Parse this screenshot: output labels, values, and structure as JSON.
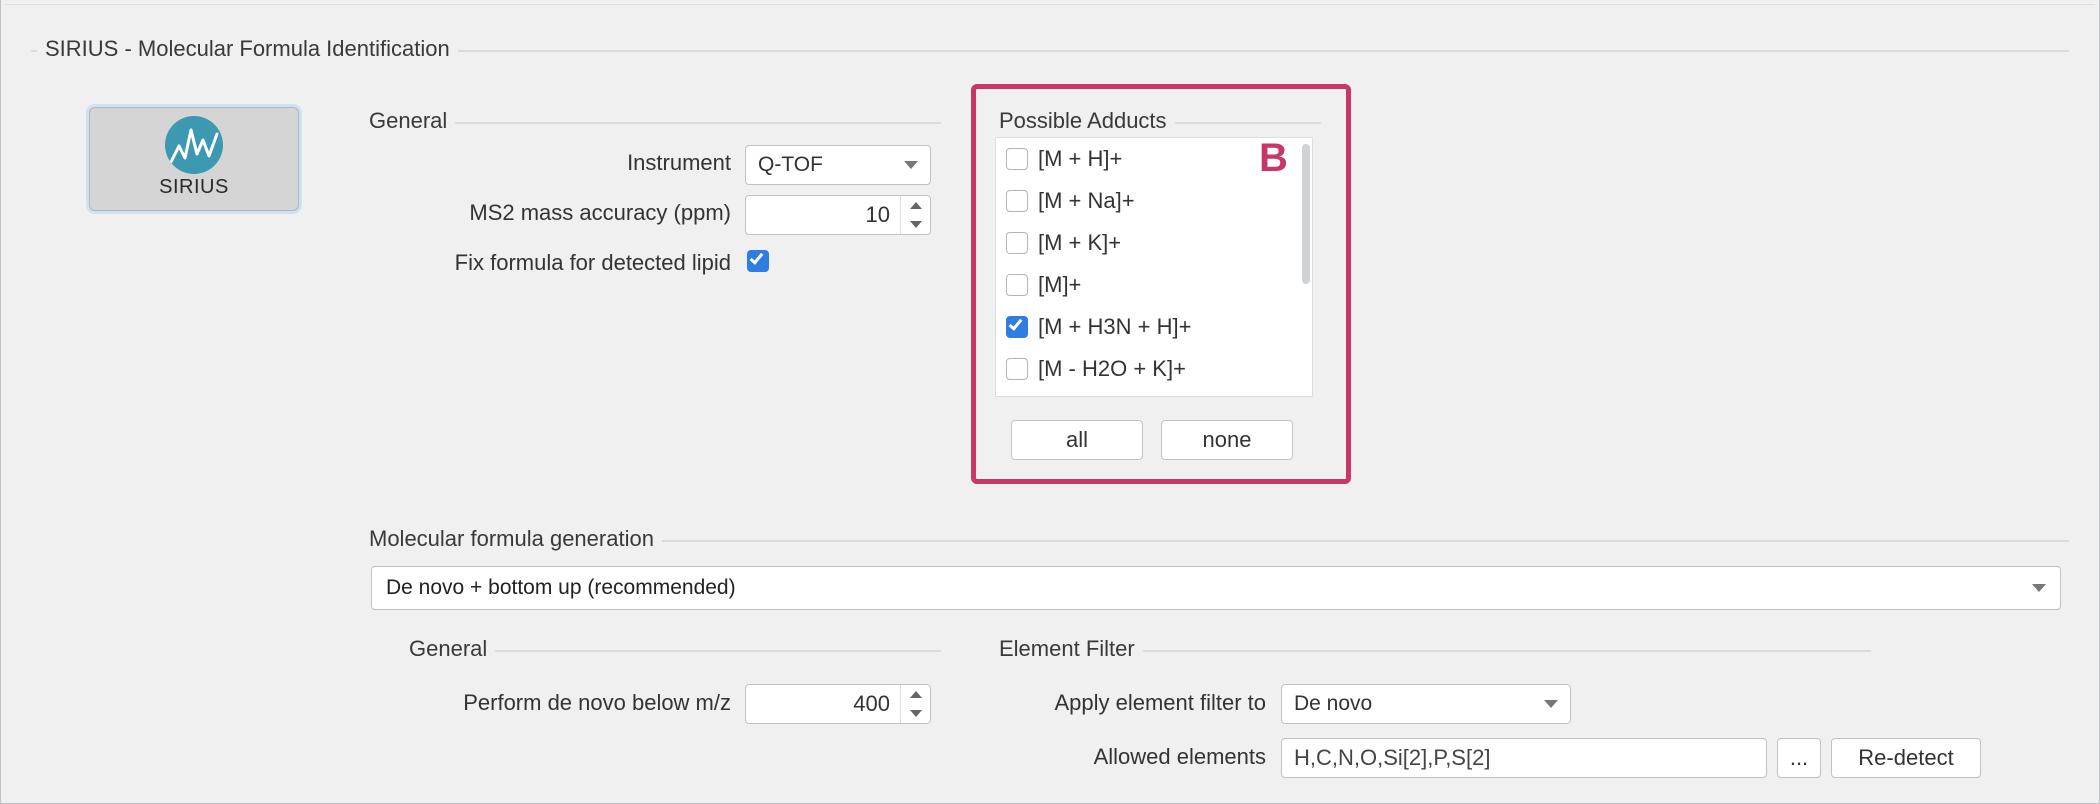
{
  "main_title": "SIRIUS - Molecular Formula Identification",
  "sirius_button": {
    "label": "SIRIUS"
  },
  "general": {
    "title": "General",
    "instrument_label": "Instrument",
    "instrument_value": "Q-TOF",
    "ms2_label": "MS2 mass accuracy (ppm)",
    "ms2_value": "10",
    "fix_label": "Fix formula for detected lipid",
    "fix_checked": true
  },
  "adducts": {
    "title": "Possible Adducts",
    "items": [
      {
        "label": "[M + H]+",
        "checked": false
      },
      {
        "label": "[M + Na]+",
        "checked": false
      },
      {
        "label": "[M + K]+",
        "checked": false
      },
      {
        "label": "[M]+",
        "checked": false
      },
      {
        "label": "[M + H3N + H]+",
        "checked": true
      },
      {
        "label": "[M - H2O + K]+",
        "checked": false
      }
    ],
    "all_label": "all",
    "none_label": "none"
  },
  "annotation": {
    "B": "B"
  },
  "mfg": {
    "title": "Molecular formula generation",
    "strategy": "De novo + bottom up (recommended)",
    "sub_general_title": "General",
    "denovo_label": "Perform de novo below m/z",
    "denovo_value": "400",
    "element_filter_title": "Element Filter",
    "apply_label": "Apply element filter to",
    "apply_value": "De novo",
    "allowed_label": "Allowed elements",
    "allowed_value": "H,C,N,O,Si[2],P,S[2]",
    "more_label": "...",
    "redetect_label": "Re-detect"
  }
}
